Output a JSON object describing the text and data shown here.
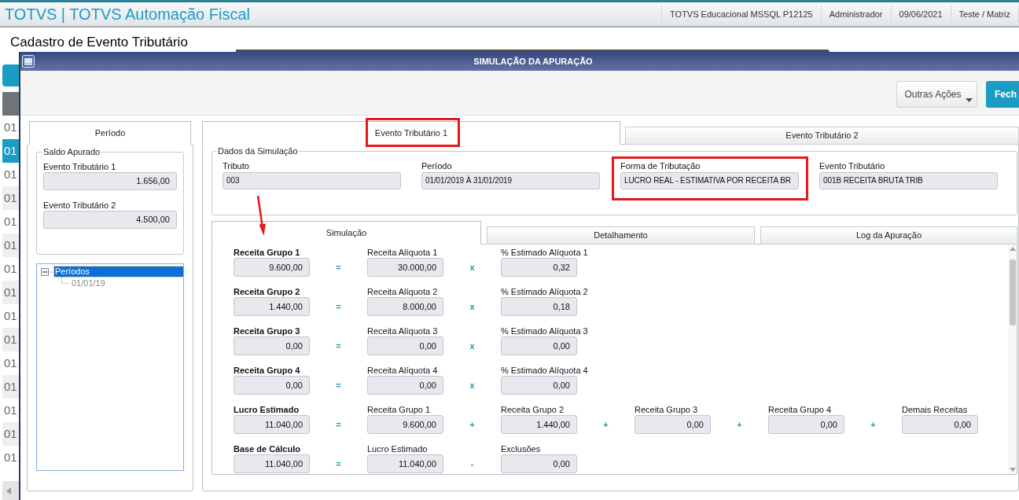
{
  "header": {
    "title": "TOTVS | TOTVS Automação Fiscal",
    "info": [
      "TOTVS Educacional MSSQL P12125",
      "Administrador",
      "09/06/2021",
      "Teste / Matriz"
    ]
  },
  "page": {
    "title": "Cadastro de Evento Tributário",
    "rows": [
      {
        "text": "01",
        "selected": false
      },
      {
        "text": "01",
        "selected": true
      },
      {
        "text": "01",
        "selected": false
      },
      {
        "text": "01",
        "selected": false
      },
      {
        "text": "01",
        "selected": false
      },
      {
        "text": "01",
        "selected": false
      },
      {
        "text": "01",
        "selected": false
      },
      {
        "text": "01",
        "selected": false
      },
      {
        "text": "01",
        "selected": false
      },
      {
        "text": "01",
        "selected": false
      },
      {
        "text": "01",
        "selected": false
      },
      {
        "text": "01",
        "selected": false
      },
      {
        "text": "01",
        "selected": false
      },
      {
        "text": "01",
        "selected": false
      },
      {
        "text": "01",
        "selected": false
      }
    ]
  },
  "dialog": {
    "title": "SIMULAÇÃO DA APURAÇÃO",
    "buttons": [
      {
        "kind": "dropdown",
        "label": "Outras Ações"
      },
      {
        "kind": "primary",
        "label": "Fech"
      }
    ],
    "left_tabs": [
      {
        "label": "Período",
        "selected": true
      }
    ],
    "saldo": {
      "legend": "Saldo Apurado",
      "fields": [
        {
          "label": "Evento Tributário 1",
          "value": "1.656,00"
        },
        {
          "label": "Evento Tributário 2",
          "value": "4.500,00"
        }
      ]
    },
    "tree": [
      {
        "label": "Períodos",
        "selected": true,
        "expanded": true,
        "children": [
          {
            "label": "01/01/19",
            "selected": false
          }
        ]
      }
    ],
    "event_tabs": [
      {
        "label": "Evento Tributário 1",
        "selected": true
      },
      {
        "label": "Evento Tributário 2",
        "selected": false
      }
    ],
    "dados": {
      "legend": "Dados da Simulação",
      "fields": [
        {
          "label": "Tributo",
          "value": "003"
        },
        {
          "label": "Período",
          "value": "01/01/2019 À 31/01/2019"
        },
        {
          "label": "Forma de Tributação",
          "value": "LUCRO REAL - ESTIMATIVA POR RECEITA BR"
        },
        {
          "label": "Evento Tributário",
          "value": "001B RECEITA BRUTA TRIB"
        }
      ]
    },
    "sub_tabs": [
      {
        "label": "Simulação",
        "selected": true
      },
      {
        "label": "Detalhamento",
        "selected": false
      },
      {
        "label": "Log da Apuração",
        "selected": false
      }
    ],
    "simulation": [
      [
        {
          "kind": "field",
          "label": "Receita Grupo 1",
          "value": "9.600,00"
        },
        {
          "kind": "operator",
          "symbol": "="
        },
        {
          "kind": "field",
          "label": "Receita Alíquota 1",
          "value": "30.000,00"
        },
        {
          "kind": "operator",
          "symbol": "x"
        },
        {
          "kind": "field",
          "label": "% Estimado Alíquota 1",
          "value": "0,32"
        }
      ],
      [
        {
          "kind": "field",
          "label": "Receita Grupo 2",
          "value": "1.440,00"
        },
        {
          "kind": "operator",
          "symbol": "="
        },
        {
          "kind": "field",
          "label": "Receita Alíquota 2",
          "value": "8.000,00"
        },
        {
          "kind": "operator",
          "symbol": "x"
        },
        {
          "kind": "field",
          "label": "% Estimado Alíquota 2",
          "value": "0,18"
        }
      ],
      [
        {
          "kind": "field",
          "label": "Receita Grupo 3",
          "value": "0,00"
        },
        {
          "kind": "operator",
          "symbol": "="
        },
        {
          "kind": "field",
          "label": "Receita Alíquota 3",
          "value": "0,00"
        },
        {
          "kind": "operator",
          "symbol": "x"
        },
        {
          "kind": "field",
          "label": "% Estimado Alíquota 3",
          "value": "0,00"
        }
      ],
      [
        {
          "kind": "field",
          "label": "Receita Grupo 4",
          "value": "0,00"
        },
        {
          "kind": "operator",
          "symbol": "="
        },
        {
          "kind": "field",
          "label": "Receita Alíquota 4",
          "value": "0,00"
        },
        {
          "kind": "operator",
          "symbol": "x"
        },
        {
          "kind": "field",
          "label": "% Estimado Alíquota 4",
          "value": "0,00"
        }
      ],
      [
        {
          "kind": "field",
          "label": "Lucro Estimado",
          "value": "11.040,00"
        },
        {
          "kind": "operator",
          "symbol": "="
        },
        {
          "kind": "field",
          "label": "Receita Grupo 1",
          "value": "9.600,00"
        },
        {
          "kind": "operator",
          "symbol": "+"
        },
        {
          "kind": "field",
          "label": "Receita Grupo 2",
          "value": "1.440,00"
        },
        {
          "kind": "operator",
          "symbol": "+"
        },
        {
          "kind": "field",
          "label": "Receita Grupo 3",
          "value": "0,00"
        },
        {
          "kind": "operator",
          "symbol": "+"
        },
        {
          "kind": "field",
          "label": "Receita Grupo 4",
          "value": "0,00"
        },
        {
          "kind": "operator",
          "symbol": "+"
        },
        {
          "kind": "field",
          "label": "Demais Receitas",
          "value": "0,00"
        }
      ],
      [
        {
          "kind": "field",
          "label": "Base de Cálculo",
          "value": "11.040,00"
        },
        {
          "kind": "operator",
          "symbol": "="
        },
        {
          "kind": "field",
          "label": "Lucro Estimado",
          "value": "11.040,00"
        },
        {
          "kind": "operator",
          "symbol": "-"
        },
        {
          "kind": "field",
          "label": "Exclusões",
          "value": "0,00"
        }
      ]
    ]
  }
}
